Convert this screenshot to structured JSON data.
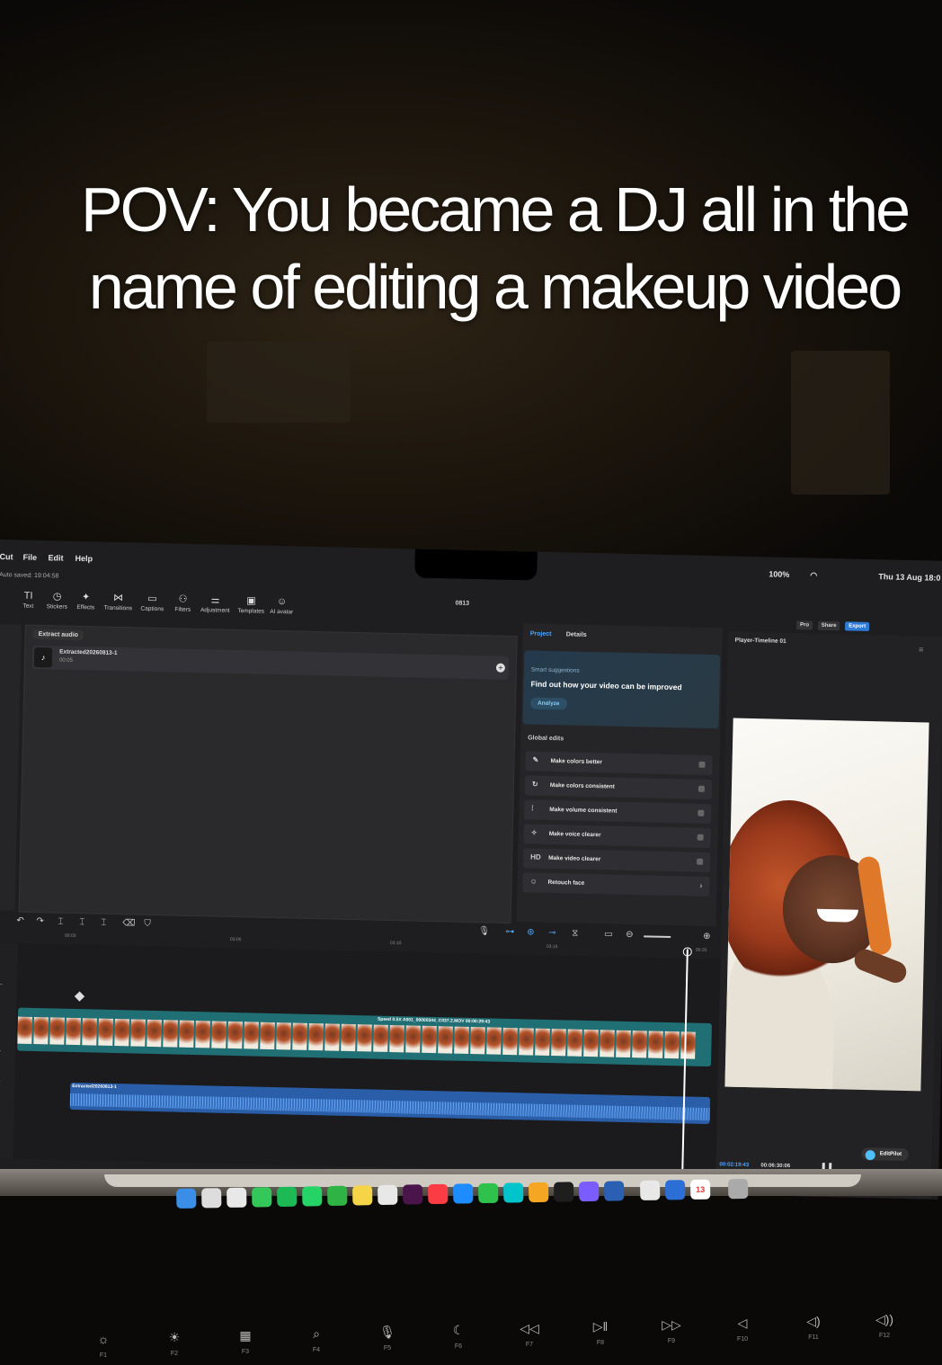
{
  "caption": "POV: You became a DJ all in the name of editing a makeup video",
  "menubar": {
    "app": "Cut",
    "file": "File",
    "edit": "Edit",
    "help": "Help",
    "date_time": "Thu 13 Aug 18:0",
    "battery": "100%"
  },
  "autosave": "Auto saved: 19:04:58",
  "project_title": "0813",
  "toolbar": [
    {
      "label": "Text",
      "icon": "TI"
    },
    {
      "label": "Stickers",
      "icon": "◷"
    },
    {
      "label": "Effects",
      "icon": "✦"
    },
    {
      "label": "Transitions",
      "icon": "⋈"
    },
    {
      "label": "Captions",
      "icon": "▭"
    },
    {
      "label": "Filters",
      "icon": "⚇"
    },
    {
      "label": "Adjustment",
      "icon": "⚌"
    },
    {
      "label": "Templates",
      "icon": "▣"
    },
    {
      "label": "AI avatar",
      "icon": "☺"
    }
  ],
  "media": {
    "extract_label": "Extract audio",
    "item_name": "Extracted20260813-1",
    "item_duration": "00:05"
  },
  "project_panel": {
    "tab_project": "Project",
    "tab_details": "Details",
    "smart_label": "Smart suggestions",
    "smart_heading": "Find out how your video can be improved",
    "analyze": "Analyze",
    "global_label": "Global edits",
    "edits": [
      {
        "icon": "✎",
        "label": "Make colors better"
      },
      {
        "icon": "↻",
        "label": "Make colors consistent"
      },
      {
        "icon": "⫶",
        "label": "Make volume consistent"
      },
      {
        "icon": "✧",
        "label": "Make voice clearer"
      },
      {
        "icon": "HD",
        "label": "Make video clearer"
      },
      {
        "icon": "☺",
        "label": "Retouch face"
      }
    ]
  },
  "player": {
    "title": "Player-Timeline 01",
    "current_time": "00:02:19:43",
    "total_time": "00:06:30:06",
    "editpilot": "EditPilot"
  },
  "top_buttons": {
    "pro": "Pro",
    "share": "Share",
    "export": "Export"
  },
  "timeline": {
    "ruler": [
      "00:00",
      "03:05",
      "03:10",
      "03:15",
      "00:20"
    ],
    "clip_info": "Speed 0.5X  A001_00000344_C037.2.MOV  00:00:29:43",
    "audio_name": "Extracted20260813-1"
  },
  "dock_icons": [
    "finder-icon",
    "launchpad-icon",
    "chrome-icon",
    "messages-icon",
    "spotify-icon",
    "whatsapp-icon",
    "numbers-icon",
    "notes-icon",
    "photos-icon",
    "slack-icon",
    "music-icon",
    "appstore-icon",
    "facetime-icon",
    "canva-icon",
    "pages-icon",
    "capcut-icon",
    "ae-icon",
    "ie-icon",
    "stack-icon",
    "files-icon",
    "calendar-icon",
    "trash-icon"
  ],
  "calendar_day": "13",
  "keys": [
    {
      "sym": "☼",
      "lbl": "F1"
    },
    {
      "sym": "☀",
      "lbl": "F2"
    },
    {
      "sym": "▦",
      "lbl": "F3"
    },
    {
      "sym": "⌕",
      "lbl": "F4"
    },
    {
      "sym": "🎙",
      "lbl": "F5"
    },
    {
      "sym": "☾",
      "lbl": "F6"
    },
    {
      "sym": "◁◁",
      "lbl": "F7"
    },
    {
      "sym": "▷‖",
      "lbl": "F8"
    },
    {
      "sym": "▷▷",
      "lbl": "F9"
    },
    {
      "sym": "◁",
      "lbl": "F10"
    },
    {
      "sym": "◁)",
      "lbl": "F11"
    },
    {
      "sym": "◁))",
      "lbl": "F12"
    }
  ]
}
